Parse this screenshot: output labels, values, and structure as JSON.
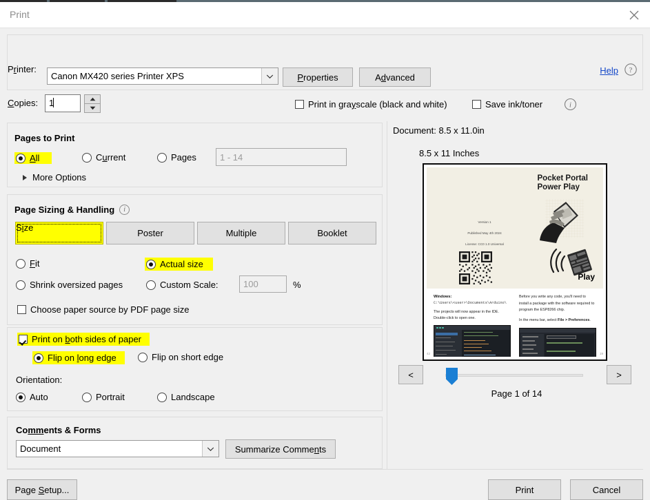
{
  "window": {
    "title": "Print",
    "close_icon": "close-icon"
  },
  "printer": {
    "label": "Printer:",
    "value": "Canon MX420 series Printer XPS",
    "dropdown_icon": "chevron-down-icon",
    "properties_label": "Properties",
    "advanced_label": "Advanced",
    "help_label": "Help",
    "help_icon": "question-circle-icon"
  },
  "copies": {
    "label": "Copies:",
    "value": "1",
    "spinner_up_icon": "triangle-up-icon",
    "spinner_down_icon": "triangle-down-icon"
  },
  "options": {
    "grayscale_label": "Print in grayscale (black and white)",
    "grayscale_checked": false,
    "save_ink_label": "Save ink/toner",
    "save_ink_checked": false,
    "info_icon": "info-circle-icon"
  },
  "pages_to_print": {
    "title": "Pages to Print",
    "items": [
      {
        "label": "All",
        "selected": true,
        "highlighted": true
      },
      {
        "label": "Current",
        "selected": false,
        "highlighted": false
      },
      {
        "label": "Pages",
        "selected": false,
        "highlighted": false
      }
    ],
    "pages_placeholder": "1 - 14",
    "more_options_label": "More Options",
    "more_options_icon": "triangle-right-icon"
  },
  "page_sizing": {
    "title": "Page Sizing & Handling",
    "info_icon": "info-circle-icon",
    "tabs": [
      {
        "label": "Size",
        "active": true,
        "highlighted": true
      },
      {
        "label": "Poster",
        "active": false,
        "highlighted": false
      },
      {
        "label": "Multiple",
        "active": false,
        "highlighted": false
      },
      {
        "label": "Booklet",
        "active": false,
        "highlighted": false
      }
    ],
    "fit_label": "Fit",
    "fit_selected": false,
    "actual_size_label": "Actual size",
    "actual_size_selected": true,
    "actual_size_highlighted": true,
    "shrink_label": "Shrink oversized pages",
    "shrink_selected": false,
    "custom_scale_label": "Custom Scale:",
    "custom_scale_selected": false,
    "custom_scale_value": "100",
    "percent_label": "%",
    "paper_source_label": "Choose paper source by PDF page size",
    "paper_source_checked": false
  },
  "duplex": {
    "both_sides_label": "Print on both sides of paper",
    "both_sides_checked": true,
    "both_sides_highlighted": true,
    "flip_long_label": "Flip on long edge",
    "flip_long_selected": true,
    "flip_long_highlighted": true,
    "flip_short_label": "Flip on short edge",
    "flip_short_selected": false,
    "orientation_label": "Orientation:",
    "orientations": [
      {
        "label": "Auto",
        "selected": true
      },
      {
        "label": "Portrait",
        "selected": false
      },
      {
        "label": "Landscape",
        "selected": false
      }
    ]
  },
  "comments": {
    "title": "Comments & Forms",
    "value": "Document",
    "dropdown_icon": "chevron-down-icon",
    "summarize_label": "Summarize Comments"
  },
  "preview": {
    "document_size": "Document: 8.5 x 11.0in",
    "paper_size": "8.5 x 11 Inches",
    "page_count_label": "Page 1 of 14",
    "prev_label": "<",
    "next_label": ">",
    "page": {
      "title_line1": "Pocket Portal",
      "title_line2": "Power Play",
      "version": "Version 1",
      "published": "Published May 4th 2024",
      "license": "License: CC0 1.0 Universal",
      "play_label": "Play",
      "qr_icon": "qr-code-icon",
      "hand_phone_icon": "hand-holding-phone-icon",
      "wifi_board_icon": "wifi-circuit-board-icon",
      "left_column": {
        "heading": "Windows:",
        "path": "C:\\Users\\<user>\\Documents\\Arduino\\",
        "body": "The projects will now appear in the IDE. Double-click to open one.",
        "page_number": "42",
        "screenshot_icon": "arduino-ide-screenshot"
      },
      "right_column": {
        "body1": "Before you write any code, you'll need to install a package with the software required to program the ESP8266 chip.",
        "body2_prefix": "In the menu bar, select ",
        "body2_bold": "File > Preferences",
        "body2_suffix": ".",
        "page_number": "19",
        "screenshot_icon": "preferences-dialog-screenshot"
      }
    }
  },
  "footer": {
    "page_setup_label": "Page Setup...",
    "print_label": "Print",
    "cancel_label": "Cancel"
  },
  "colors": {
    "highlight": "#ffff00",
    "link": "#1246c8",
    "slider": "#1a7fd4",
    "dialog_bg": "#f0f0f0"
  }
}
